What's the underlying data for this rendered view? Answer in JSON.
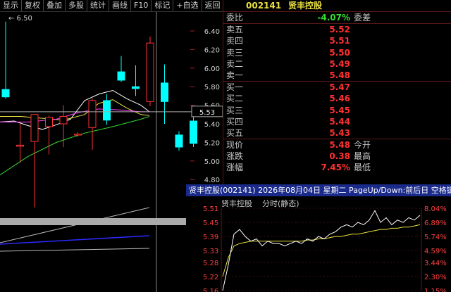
{
  "toolbar": {
    "buttons": [
      "显示",
      "复权",
      "叠加",
      "多股",
      "统计",
      "画线",
      "F10",
      "标记",
      "+自选",
      "返回"
    ]
  },
  "kline": {
    "price_axis": [
      "6.40",
      "6.20",
      "6.00",
      "5.80",
      "5.60",
      "5.40",
      "5.20",
      "5.00",
      "4.80"
    ],
    "crosshair_price": "5.53",
    "max_label": "6.50",
    "colors": {
      "up": "#ff3232",
      "down": "#00ffff",
      "ma5": "#ffffff",
      "ma10": "#e8e040",
      "ma20": "#ff40ff",
      "ma60": "#33dd33"
    }
  },
  "quote": {
    "code": "002141",
    "name": "贤丰控股",
    "weibi_label": "委比",
    "weibi_value": "-4.07%",
    "weicha_label": "委差",
    "asks": [
      {
        "label": "卖五",
        "price": "5.52"
      },
      {
        "label": "卖四",
        "price": "5.51"
      },
      {
        "label": "卖三",
        "price": "5.50"
      },
      {
        "label": "卖二",
        "price": "5.49"
      },
      {
        "label": "卖一",
        "price": "5.48"
      }
    ],
    "bids": [
      {
        "label": "买一",
        "price": "5.47"
      },
      {
        "label": "买二",
        "price": "5.46"
      },
      {
        "label": "买三",
        "price": "5.45"
      },
      {
        "label": "买四",
        "price": "5.44"
      },
      {
        "label": "买五",
        "price": "5.43"
      }
    ],
    "stats": [
      {
        "label": "现价",
        "value": "5.48",
        "label2": "今开"
      },
      {
        "label": "涨跌",
        "value": "0.38",
        "label2": "最高"
      },
      {
        "label": "涨幅",
        "value": "7.45%",
        "label2": "最低"
      }
    ]
  },
  "popup": {
    "title": "贤丰控股(002141) 2026年08月04日 星期二 PageUp/Down:前后日 空格键:操作",
    "stock_name": "贤丰控股",
    "mode": "分时(静态)",
    "left_axis": [
      "5.51",
      "5.45",
      "5.39",
      "5.33",
      "5.28",
      "5.22",
      "5.16"
    ],
    "right_axis": [
      "8.04%",
      "6.89%",
      "5.74%",
      "4.59%",
      "3.44%",
      "2.30%",
      "1.15%"
    ]
  },
  "chart_data": [
    {
      "type": "candlestick",
      "title": "",
      "ylim": [
        4.73,
        6.55
      ],
      "candles": [
        {
          "o": 5.77,
          "h": 6.5,
          "l": 5.67,
          "c": 5.69
        },
        {
          "o": 5.17,
          "h": 5.4,
          "l": 4.98,
          "c": 5.17
        },
        {
          "o": 5.21,
          "h": 5.32,
          "l": 4.5,
          "c": 5.5
        },
        {
          "o": 5.37,
          "h": 5.49,
          "l": 5.07,
          "c": 5.47
        },
        {
          "o": 5.4,
          "h": 5.6,
          "l": 5.15,
          "c": 5.48
        },
        {
          "o": 5.28,
          "h": 5.31,
          "l": 5.26,
          "c": 5.29
        },
        {
          "o": 5.36,
          "h": 5.67,
          "l": 5.12,
          "c": 5.65
        },
        {
          "o": 5.65,
          "h": 5.72,
          "l": 5.39,
          "c": 5.44
        },
        {
          "o": 5.96,
          "h": 6.13,
          "l": 5.85,
          "c": 5.87
        },
        {
          "o": 5.8,
          "h": 6.03,
          "l": 5.7,
          "c": 5.78
        },
        {
          "o": 5.64,
          "h": 6.34,
          "l": 5.59,
          "c": 6.27
        },
        {
          "o": 5.84,
          "h": 6.04,
          "l": 5.4,
          "c": 5.64
        },
        {
          "o": 5.28,
          "h": 5.32,
          "l": 5.11,
          "c": 5.15
        },
        {
          "o": 5.43,
          "h": 5.48,
          "l": 5.15,
          "c": 5.19
        }
      ]
    },
    {
      "type": "line",
      "title": "",
      "ylim": [
        5.16,
        5.51
      ],
      "series": [
        {
          "name": "",
          "values": [
            5.16,
            5.27,
            5.4,
            5.42,
            5.39,
            5.37,
            5.38,
            5.35,
            5.37,
            5.36,
            5.36,
            5.35,
            5.36,
            5.37,
            5.36,
            5.38,
            5.37,
            5.39,
            5.38,
            5.4,
            5.41,
            5.43,
            5.44,
            5.43,
            5.45,
            5.44,
            5.46,
            5.5,
            5.45,
            5.47,
            5.44,
            5.46,
            5.45,
            5.47,
            5.46,
            5.48
          ]
        },
        {
          "name": "",
          "values": [
            5.22,
            5.3,
            5.35,
            5.36,
            5.365,
            5.37,
            5.37,
            5.37,
            5.37,
            5.37,
            5.37,
            5.37,
            5.37,
            5.37,
            5.37,
            5.375,
            5.375,
            5.38,
            5.38,
            5.385,
            5.39,
            5.39,
            5.395,
            5.4,
            5.4,
            5.405,
            5.41,
            5.415,
            5.42,
            5.42,
            5.425,
            5.425,
            5.43,
            5.43,
            5.435,
            5.44
          ]
        }
      ]
    }
  ]
}
